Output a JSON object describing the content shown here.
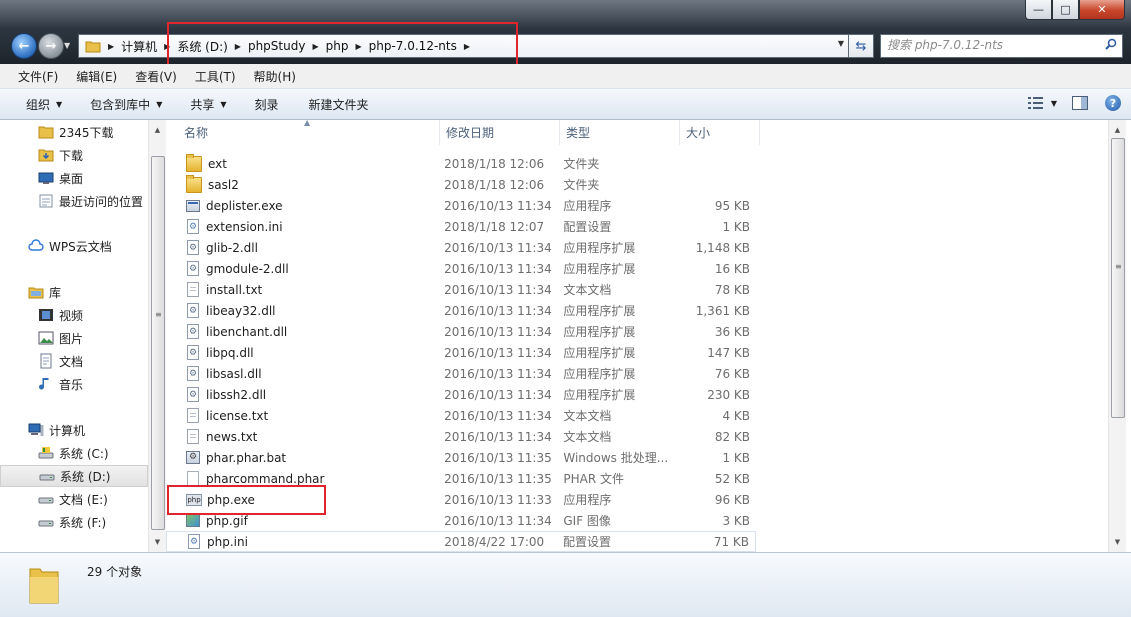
{
  "window": {
    "controls": {
      "minimize": "—",
      "maximize": "□",
      "close": "✕"
    }
  },
  "address": {
    "breadcrumbs": [
      "计算机",
      "系统 (D:)",
      "phpStudy",
      "php",
      "php-7.0.12-nts"
    ]
  },
  "search": {
    "placeholder": "搜索 php-7.0.12-nts"
  },
  "menu": [
    "文件(F)",
    "编辑(E)",
    "查看(V)",
    "工具(T)",
    "帮助(H)"
  ],
  "toolbar": {
    "organize": "组织",
    "include_in_library": "包含到库中",
    "share": "共享",
    "burn": "刻录",
    "new_folder": "新建文件夹",
    "help": "?"
  },
  "sidebar": {
    "items": [
      {
        "label": "2345下载",
        "icon": "folder-icon"
      },
      {
        "label": "下载",
        "icon": "download-folder-icon"
      },
      {
        "label": "桌面",
        "icon": "desktop-icon"
      },
      {
        "label": "最近访问的位置",
        "icon": "recent-places-icon"
      },
      {
        "label": "WPS云文档",
        "icon": "cloud-icon"
      },
      {
        "label": "库",
        "icon": "library-icon"
      },
      {
        "label": "视频",
        "icon": "video-library-icon"
      },
      {
        "label": "图片",
        "icon": "pictures-library-icon"
      },
      {
        "label": "文档",
        "icon": "documents-library-icon"
      },
      {
        "label": "音乐",
        "icon": "music-library-icon"
      },
      {
        "label": "计算机",
        "icon": "computer-icon"
      },
      {
        "label": "系统 (C:)",
        "icon": "drive-c-icon"
      },
      {
        "label": "系统 (D:)",
        "icon": "drive-d-icon",
        "selected": true
      },
      {
        "label": "文档 (E:)",
        "icon": "drive-e-icon"
      },
      {
        "label": "系统 (F:)",
        "icon": "drive-f-icon"
      }
    ]
  },
  "filelist": {
    "columns": {
      "name": "名称",
      "date": "修改日期",
      "type": "类型",
      "size": "大小"
    },
    "rows": [
      {
        "name": "ext",
        "date": "2018/1/18 12:06",
        "type": "文件夹",
        "size": "",
        "icon": "folder"
      },
      {
        "name": "sasl2",
        "date": "2018/1/18 12:06",
        "type": "文件夹",
        "size": "",
        "icon": "folder"
      },
      {
        "name": "deplister.exe",
        "date": "2016/10/13 11:34",
        "type": "应用程序",
        "size": "95 KB",
        "icon": "exe"
      },
      {
        "name": "extension.ini",
        "date": "2018/1/18 12:07",
        "type": "配置设置",
        "size": "1 KB",
        "icon": "ini"
      },
      {
        "name": "glib-2.dll",
        "date": "2016/10/13 11:34",
        "type": "应用程序扩展",
        "size": "1,148 KB",
        "icon": "dll"
      },
      {
        "name": "gmodule-2.dll",
        "date": "2016/10/13 11:34",
        "type": "应用程序扩展",
        "size": "16 KB",
        "icon": "dll"
      },
      {
        "name": "install.txt",
        "date": "2016/10/13 11:34",
        "type": "文本文档",
        "size": "78 KB",
        "icon": "doc"
      },
      {
        "name": "libeay32.dll",
        "date": "2016/10/13 11:34",
        "type": "应用程序扩展",
        "size": "1,361 KB",
        "icon": "dll"
      },
      {
        "name": "libenchant.dll",
        "date": "2016/10/13 11:34",
        "type": "应用程序扩展",
        "size": "36 KB",
        "icon": "dll"
      },
      {
        "name": "libpq.dll",
        "date": "2016/10/13 11:34",
        "type": "应用程序扩展",
        "size": "147 KB",
        "icon": "dll"
      },
      {
        "name": "libsasl.dll",
        "date": "2016/10/13 11:34",
        "type": "应用程序扩展",
        "size": "76 KB",
        "icon": "dll"
      },
      {
        "name": "libssh2.dll",
        "date": "2016/10/13 11:34",
        "type": "应用程序扩展",
        "size": "230 KB",
        "icon": "dll"
      },
      {
        "name": "license.txt",
        "date": "2016/10/13 11:34",
        "type": "文本文档",
        "size": "4 KB",
        "icon": "doc"
      },
      {
        "name": "news.txt",
        "date": "2016/10/13 11:34",
        "type": "文本文档",
        "size": "82 KB",
        "icon": "doc"
      },
      {
        "name": "phar.phar.bat",
        "date": "2016/10/13 11:35",
        "type": "Windows 批处理...",
        "size": "1 KB",
        "icon": "bat"
      },
      {
        "name": "pharcommand.phar",
        "date": "2016/10/13 11:35",
        "type": "PHAR 文件",
        "size": "52 KB",
        "icon": "blank"
      },
      {
        "name": "php.exe",
        "date": "2016/10/13 11:33",
        "type": "应用程序",
        "size": "96 KB",
        "icon": "php"
      },
      {
        "name": "php.gif",
        "date": "2016/10/13 11:34",
        "type": "GIF 图像",
        "size": "3 KB",
        "icon": "gif"
      },
      {
        "name": "php.ini",
        "date": "2018/4/22 17:00",
        "type": "配置设置",
        "size": "71 KB",
        "icon": "ini",
        "selected": true
      }
    ]
  },
  "status": {
    "count_text": "29 个对象"
  },
  "colors": {
    "highlight_box": "#e0262c",
    "accent": "#2e6fc0"
  }
}
